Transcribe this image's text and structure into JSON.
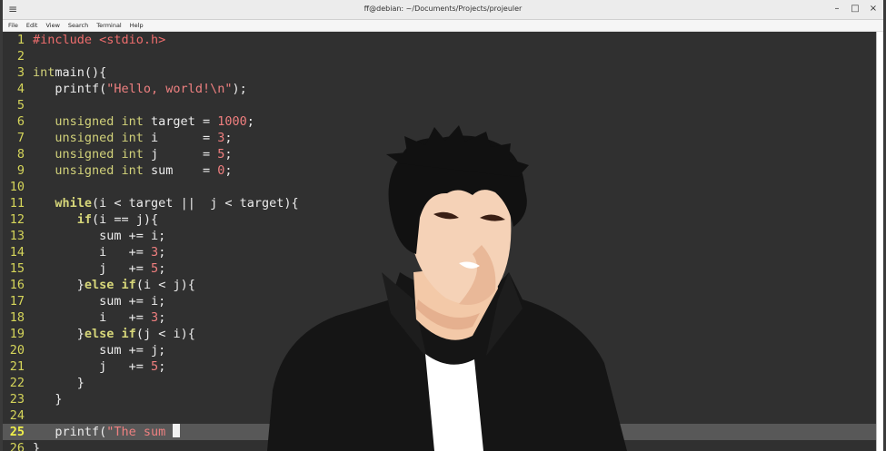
{
  "window": {
    "title": "ff@debian: ~/Documents/Projects/projeuler"
  },
  "menu": [
    "File",
    "Edit",
    "View",
    "Search",
    "Terminal",
    "Help"
  ],
  "editor": {
    "current_line": 25,
    "lines": [
      {
        "n": "1",
        "t": [
          [
            "pp",
            "#include <stdio.h>"
          ]
        ]
      },
      {
        "n": "2",
        "t": []
      },
      {
        "n": "3",
        "t": [
          [
            "ty",
            "int"
          ],
          [
            "",
            "main(){"
          ]
        ]
      },
      {
        "n": "4",
        "t": [
          [
            "",
            "   printf("
          ],
          [
            "st",
            "\"Hello, world!\\n\""
          ],
          [
            "",
            ");"
          ]
        ]
      },
      {
        "n": "5",
        "t": []
      },
      {
        "n": "6",
        "t": [
          [
            "ty",
            "   unsigned int"
          ],
          [
            "",
            " target = "
          ],
          [
            "nm",
            "1000"
          ],
          [
            "",
            ";"
          ]
        ]
      },
      {
        "n": "7",
        "t": [
          [
            "ty",
            "   unsigned int"
          ],
          [
            "",
            " i      = "
          ],
          [
            "nm",
            "3"
          ],
          [
            "",
            ";"
          ]
        ]
      },
      {
        "n": "8",
        "t": [
          [
            "ty",
            "   unsigned int"
          ],
          [
            "",
            " j      = "
          ],
          [
            "nm",
            "5"
          ],
          [
            "",
            ";"
          ]
        ]
      },
      {
        "n": "9",
        "t": [
          [
            "ty",
            "   unsigned int"
          ],
          [
            "",
            " sum    = "
          ],
          [
            "nm",
            "0"
          ],
          [
            "",
            ";"
          ]
        ]
      },
      {
        "n": "10",
        "t": []
      },
      {
        "n": "11",
        "t": [
          [
            "kw",
            "   while"
          ],
          [
            "",
            "(i < target ||  j < target){"
          ]
        ]
      },
      {
        "n": "12",
        "t": [
          [
            "kw",
            "      if"
          ],
          [
            "",
            "(i == j){"
          ]
        ]
      },
      {
        "n": "13",
        "t": [
          [
            "",
            "         sum += i;"
          ]
        ]
      },
      {
        "n": "14",
        "t": [
          [
            "",
            "         i   += "
          ],
          [
            "nm",
            "3"
          ],
          [
            "",
            ";"
          ]
        ]
      },
      {
        "n": "15",
        "t": [
          [
            "",
            "         j   += "
          ],
          [
            "nm",
            "5"
          ],
          [
            "",
            ";"
          ]
        ]
      },
      {
        "n": "16",
        "t": [
          [
            "",
            "      }"
          ],
          [
            "kw",
            "else if"
          ],
          [
            "",
            "(i < j){"
          ]
        ]
      },
      {
        "n": "17",
        "t": [
          [
            "",
            "         sum += i;"
          ]
        ]
      },
      {
        "n": "18",
        "t": [
          [
            "",
            "         i   += "
          ],
          [
            "nm",
            "3"
          ],
          [
            "",
            ";"
          ]
        ]
      },
      {
        "n": "19",
        "t": [
          [
            "",
            "      }"
          ],
          [
            "kw",
            "else if"
          ],
          [
            "",
            "(j < i){"
          ]
        ]
      },
      {
        "n": "20",
        "t": [
          [
            "",
            "         sum += j;"
          ]
        ]
      },
      {
        "n": "21",
        "t": [
          [
            "",
            "         j   += "
          ],
          [
            "nm",
            "5"
          ],
          [
            "",
            ";"
          ]
        ]
      },
      {
        "n": "22",
        "t": [
          [
            "",
            "      }"
          ]
        ]
      },
      {
        "n": "23",
        "t": [
          [
            "",
            "   }"
          ]
        ]
      },
      {
        "n": "24",
        "t": []
      },
      {
        "n": "25",
        "t": [
          [
            "",
            "   printf("
          ],
          [
            "st",
            "\"The sum "
          ]
        ]
      },
      {
        "n": "26",
        "t": [
          [
            "",
            "}"
          ]
        ]
      }
    ]
  },
  "colors": {
    "editor_bg": "#303030",
    "line_number": "#d5d55a",
    "string": "#ee8080",
    "number": "#f07f7f",
    "keyword": "#d7d77a",
    "preprocessor": "#ee6d6d"
  }
}
